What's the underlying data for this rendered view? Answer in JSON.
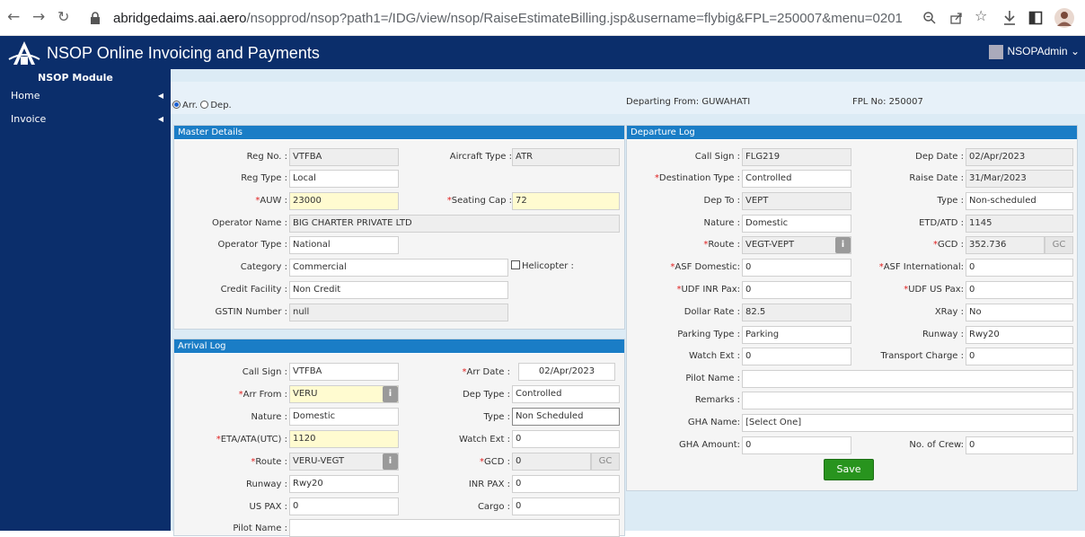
{
  "browser": {
    "url_host": "abridgedaims.aai.aero",
    "url_path": "/nsopprod/nsop?path1=/IDG/view/nsop/RaiseEstimateBilling.jsp&username=flybig&FPL=250007&menu=0201",
    "icons": [
      "back-icon",
      "forward-icon",
      "reload-icon",
      "lock-icon",
      "zoom-icon",
      "share-icon",
      "star-icon",
      "download-icon",
      "sidepanel-icon",
      "profile-icon"
    ]
  },
  "app": {
    "title": "NSOP Online Invoicing and Payments",
    "user": "NSOPAdmin"
  },
  "sidebar": {
    "header": "NSOP Module",
    "items": [
      {
        "label": "Home"
      },
      {
        "label": "Invoice"
      }
    ]
  },
  "top": {
    "arr_label": "Arr.",
    "dep_label": "Dep.",
    "selected": "Arr.",
    "departing_from": "Departing From: GUWAHATI",
    "fpl_no": "FPL No: 250007"
  },
  "master": {
    "title": "Master Details",
    "reg_no_label": "Reg No. :",
    "reg_no": "VTFBA",
    "aircraft_type_label": "Aircraft Type :",
    "aircraft_type": "ATR",
    "reg_type_label": "Reg Type :",
    "reg_type": "Local",
    "auw_label": "AUW :",
    "auw": "23000",
    "seating_cap_label": "Seating Cap :",
    "seating_cap": "72",
    "operator_name_label": "Operator Name :",
    "operator_name": "BIG CHARTER PRIVATE LTD",
    "operator_type_label": "Operator Type :",
    "operator_type": "National",
    "category_label": "Category :",
    "category": "Commercial",
    "helicopter_label": "Helicopter :",
    "credit_facility_label": "Credit Facility :",
    "credit_facility": "Non Credit",
    "gstin_label": "GSTIN Number :",
    "gstin": "null"
  },
  "arrival": {
    "title": "Arrival Log",
    "call_sign_label": "Call Sign :",
    "call_sign": "VTFBA",
    "arr_date_label": "Arr Date :",
    "arr_date": "02/Apr/2023",
    "arr_from_label": "Arr From :",
    "arr_from": "VERU",
    "dep_type_label": "Dep Type :",
    "dep_type": "Controlled",
    "nature_label": "Nature :",
    "nature": "Domestic",
    "type_label": "Type :",
    "type": "Non Scheduled",
    "eta_label": "ETA/ATA(UTC) :",
    "eta": "1120",
    "watch_ext_label": "Watch Ext :",
    "watch_ext": "0",
    "route_label": "Route :",
    "route": "VERU-VEGT",
    "gcd_label": "GCD :",
    "gcd": "0",
    "gc_button": "GC",
    "runway_label": "Runway :",
    "runway": "Rwy20",
    "inr_pax_label": "INR PAX :",
    "inr_pax": "0",
    "us_pax_label": "US PAX :",
    "us_pax": "0",
    "cargo_label": "Cargo :",
    "cargo": "0",
    "pilot_name_label": "Pilot Name :",
    "pilot_name": ""
  },
  "departure": {
    "title": "Departure Log",
    "call_sign_label": "Call Sign :",
    "call_sign": "FLG219",
    "dep_date_label": "Dep Date :",
    "dep_date": "02/Apr/2023",
    "dest_type_label": "Destination Type :",
    "dest_type": "Controlled",
    "raise_date_label": "Raise Date :",
    "raise_date": "31/Mar/2023",
    "dep_to_label": "Dep To :",
    "dep_to": "VEPT",
    "type_label": "Type :",
    "type": "Non-scheduled",
    "nature_label": "Nature :",
    "nature": "Domestic",
    "etd_label": "ETD/ATD :",
    "etd": "1145",
    "route_label": "Route :",
    "route": "VEGT-VEPT",
    "gcd_label": "GCD :",
    "gcd": "352.736",
    "gc_button": "GC",
    "asf_dom_label": "ASF Domestic:",
    "asf_dom": "0",
    "asf_int_label": "ASF International:",
    "asf_int": "0",
    "udf_inr_label": "UDF INR Pax:",
    "udf_inr": "0",
    "udf_us_label": "UDF US Pax:",
    "udf_us": "0",
    "dollar_rate_label": "Dollar Rate :",
    "dollar_rate": "82.5",
    "xray_label": "XRay :",
    "xray": "No",
    "parking_type_label": "Parking Type :",
    "parking_type": "Parking",
    "runway_label": "Runway :",
    "runway": "Rwy20",
    "watch_ext_label": "Watch Ext :",
    "watch_ext": "0",
    "transport_label": "Transport Charge :",
    "transport": "0",
    "pilot_name_label": "Pilot Name :",
    "pilot_name": "",
    "remarks_label": "Remarks :",
    "remarks": "",
    "gha_name_label": "GHA Name:",
    "gha_name": "[Select One]",
    "gha_amount_label": "GHA Amount:",
    "gha_amount": "0",
    "crew_label": "No. of Crew:",
    "crew": "0",
    "save_label": "Save"
  }
}
